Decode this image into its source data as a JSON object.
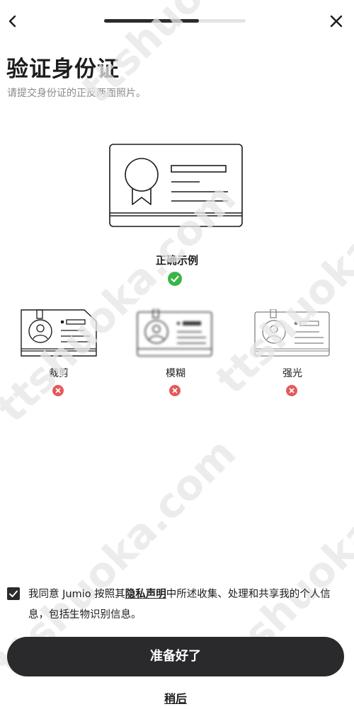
{
  "nav": {
    "back_icon": "chevron-left-icon",
    "close_icon": "close-icon",
    "progress": 0.67
  },
  "page": {
    "title": "验证身份证",
    "subtitle": "请提交身份证的正反两面照片。"
  },
  "correct_example": {
    "label": "正确示例",
    "status_icon": "check-circle-icon",
    "status_color": "#3bb54a"
  },
  "bad_examples": [
    {
      "label": "裁剪",
      "status_icon": "x-circle-icon"
    },
    {
      "label": "模糊",
      "status_icon": "x-circle-icon"
    },
    {
      "label": "强光",
      "status_icon": "x-circle-icon"
    }
  ],
  "error_color": "#e45a5a",
  "consent": {
    "checked": true,
    "text_before": "我同意 Jumio 按照其",
    "link_text": "隐私声明",
    "text_after": "中所述收集、处理和共享我的个人信息，包括生物识别信息。"
  },
  "actions": {
    "primary_label": "准备好了",
    "secondary_label": "稍后"
  },
  "watermark": "ttshuoka.com"
}
